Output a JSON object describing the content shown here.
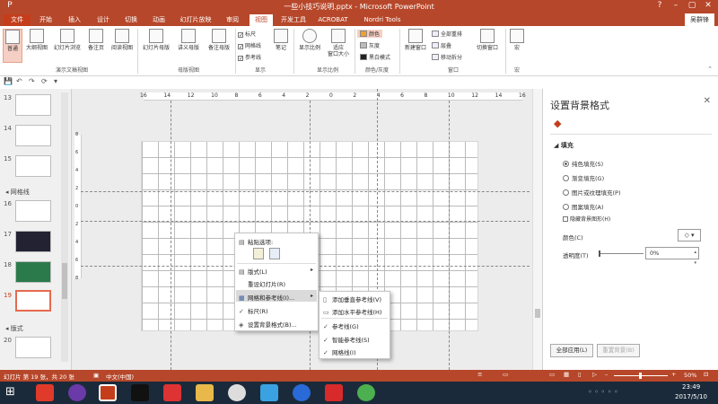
{
  "window": {
    "title": "一些小技巧说明.pptx - Microsoft PowerPoint",
    "help": "?",
    "minimize": "–",
    "restore": "▢",
    "close": "✕"
  },
  "tabs": [
    "文件",
    "开始",
    "插入",
    "设计",
    "切换",
    "动画",
    "幻灯片放映",
    "审阅",
    "视图",
    "开发工具",
    "ACROBAT",
    "Nordri Tools"
  ],
  "active_tab": "视图",
  "user": "吴群锋",
  "ribbon": {
    "presentation_views": {
      "items": [
        "普通",
        "大纲视图",
        "幻灯片浏览",
        "备注页",
        "阅读视图"
      ],
      "group": "演示文稿视图"
    },
    "master_views": {
      "items": [
        "幻灯片母版",
        "讲义母版",
        "备注母版"
      ],
      "group": "母版视图"
    },
    "show": {
      "checks": [
        {
          "label": "标尺",
          "checked": true
        },
        {
          "label": "网格线",
          "checked": true
        },
        {
          "label": "参考线",
          "checked": true
        }
      ],
      "notes": "笔记",
      "group": "显示"
    },
    "zoom": {
      "items": [
        "显示比例",
        "适应\n窗口大小"
      ],
      "group": "显示比例"
    },
    "color": {
      "items": [
        "颜色",
        "灰度",
        "黑白模式"
      ],
      "group": "颜色/灰度"
    },
    "window": {
      "new_window": "新建窗口",
      "items": [
        "全部重排",
        "层叠",
        "移动拆分"
      ],
      "switch": "切换窗口",
      "group": "窗口"
    },
    "macro": {
      "label": "宏",
      "group": "宏"
    }
  },
  "qat": [
    "💾",
    "↶",
    "↷",
    "⟳",
    "▾"
  ],
  "thumbnails": [
    {
      "num": "13"
    },
    {
      "num": "14"
    },
    {
      "num": "15"
    },
    {
      "section": "网格线"
    },
    {
      "num": "16"
    },
    {
      "num": "17"
    },
    {
      "num": "18"
    },
    {
      "num": "19",
      "current": true
    },
    {
      "section": "版式"
    },
    {
      "num": "20"
    }
  ],
  "ruler": {
    "h": [
      "16",
      "14",
      "12",
      "10",
      "8",
      "6",
      "4",
      "2",
      "0",
      "2",
      "4",
      "6",
      "8",
      "10",
      "12",
      "14",
      "16"
    ],
    "v": [
      "8",
      "6",
      "4",
      "2",
      "0",
      "2",
      "4",
      "6",
      "8"
    ]
  },
  "context_menu": {
    "paste_header": "粘贴选项:",
    "items": [
      {
        "label": "版式(L)",
        "icon": "▤",
        "arrow": "▸"
      },
      {
        "label": "重设幻灯片(R)",
        "icon": ""
      },
      {
        "label": "网格和参考线(I)...",
        "icon": "▦",
        "arrow": "▸",
        "hover": true
      },
      {
        "label": "标尺(R)",
        "icon": "✓"
      },
      {
        "label": "设置背景格式(B)...",
        "icon": "◈"
      }
    ]
  },
  "submenu": {
    "items": [
      {
        "label": "添加垂直参考线(V)",
        "icon": "▯"
      },
      {
        "label": "添加水平参考线(H)",
        "icon": "▭"
      },
      {
        "label": "参考线(G)",
        "icon": "✓"
      },
      {
        "label": "智能参考线(S)",
        "icon": "✓"
      },
      {
        "label": "网格线(I)",
        "icon": "✓"
      }
    ]
  },
  "format_pane": {
    "title": "设置背景格式",
    "close": "✕",
    "section": "填充",
    "options": [
      {
        "label": "纯色填充(S)",
        "selected": true
      },
      {
        "label": "渐变填充(G)",
        "selected": false
      },
      {
        "label": "图片或纹理填充(P)",
        "selected": false
      },
      {
        "label": "图案填充(A)",
        "selected": false
      }
    ],
    "hide_bg": "隐藏背景图形(H)",
    "color_label": "颜色(C)",
    "transparency_label": "透明度(T)",
    "transparency": "0%",
    "apply_all": "全部应用(L)",
    "reset": "重置背景(B)"
  },
  "status": {
    "slide": "幻灯片 第 19 张，共 20 张",
    "lang": "中文(中国)",
    "zoom": "50%"
  },
  "taskbar": {
    "time": "23:49",
    "date": "2017/5/10"
  }
}
